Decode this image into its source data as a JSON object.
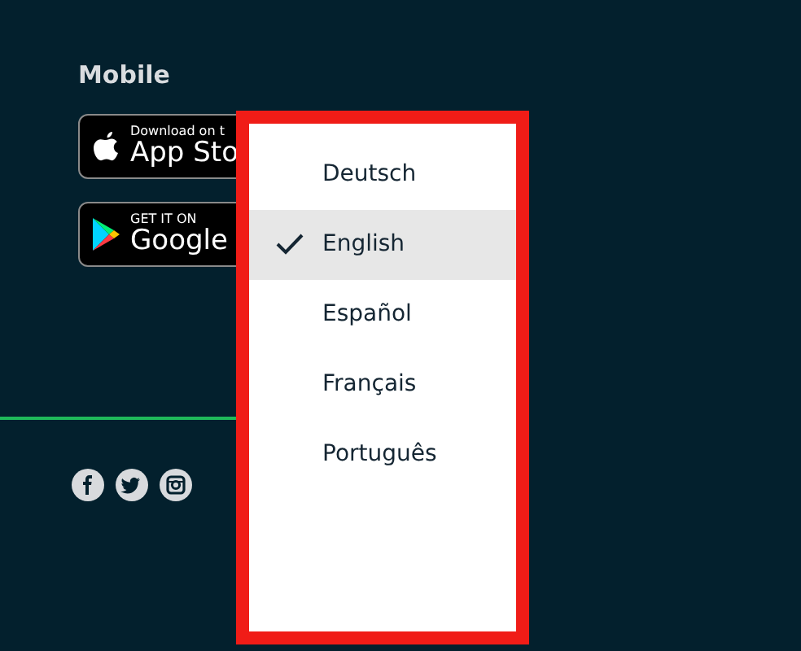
{
  "section": {
    "title": "Mobile"
  },
  "store_badges": [
    {
      "kind": "apple",
      "small": "Download on t",
      "large": "App Sto"
    },
    {
      "kind": "google",
      "small": "GET IT ON",
      "large": "Google"
    }
  ],
  "social": [
    {
      "kind": "facebook"
    },
    {
      "kind": "twitter"
    },
    {
      "kind": "instagram"
    }
  ],
  "language_menu": {
    "items": [
      {
        "label": "Deutsch",
        "selected": false
      },
      {
        "label": "English",
        "selected": true
      },
      {
        "label": "Español",
        "selected": false
      },
      {
        "label": "Français",
        "selected": false
      },
      {
        "label": "Português",
        "selected": false
      }
    ]
  }
}
